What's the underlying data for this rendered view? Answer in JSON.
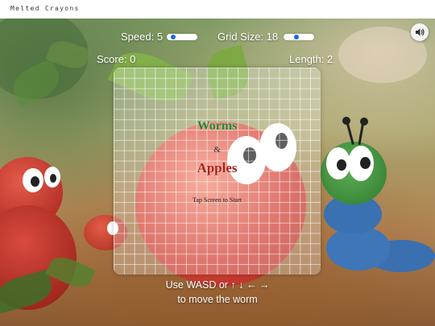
{
  "site": {
    "title": "Melted Crayons"
  },
  "hud": {
    "speed_label": "Speed: 5",
    "speed_value": 5,
    "grid_label": "Grid Size: 18",
    "grid_value": 18,
    "score_label": "Score: 0",
    "length_label": "Length: 2",
    "sound_icon": "speaker-icon"
  },
  "board": {
    "title_worms": "Worms",
    "title_amp": "&",
    "title_apples": "Apples",
    "start_prompt": "Tap Screen to Start"
  },
  "instructions": {
    "line1": "Use WASD or ↑ ↓ ← →",
    "line2": "to move the worm"
  },
  "colors": {
    "worms_title": "#1f8a2a",
    "apples_title": "#b0201a",
    "slider_thumb": "#1e6ad6"
  }
}
